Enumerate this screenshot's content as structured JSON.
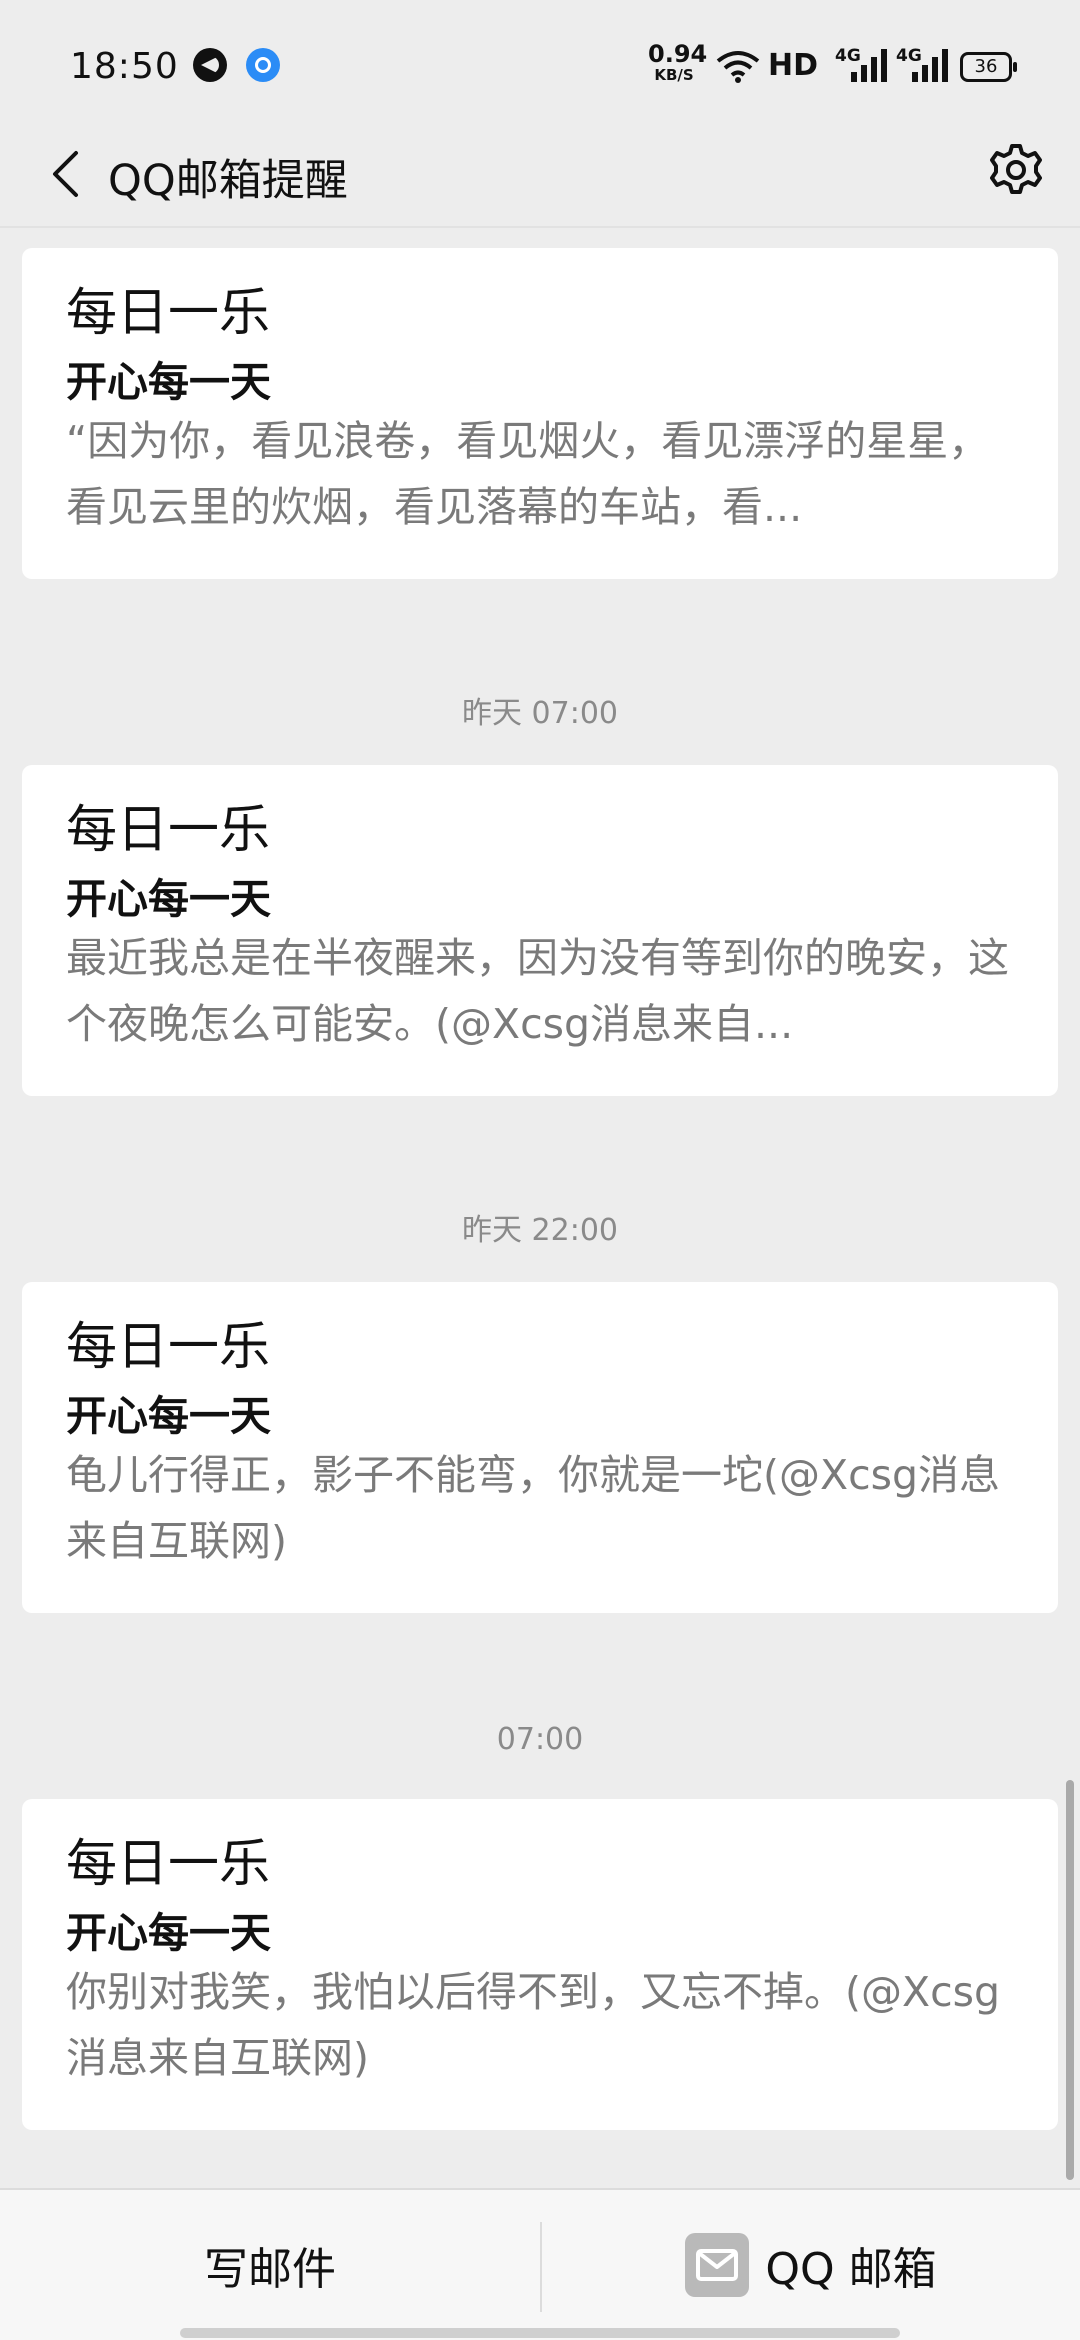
{
  "status_bar": {
    "time": "18:50",
    "net_speed_value": "0.94",
    "net_speed_unit": "KB/S",
    "hd_label": "HD",
    "sim1_label": "4G",
    "sim2_label": "4G",
    "battery": "36"
  },
  "header": {
    "title": "QQ邮箱提醒"
  },
  "feed": [
    {
      "time": "",
      "title": "每日一乐",
      "subtitle": "开心每一天",
      "body": "“因为你，看见浪卷，看见烟火，看见漂浮的星星，看见云里的炊烟，看见落幕的车站，看..."
    },
    {
      "time": "昨天 07:00",
      "title": "每日一乐",
      "subtitle": "开心每一天",
      "body": "最近我总是在半夜醒来，因为没有等到你的晚安，这个夜晚怎么可能安。(@Xcsg消息来自..."
    },
    {
      "time": "昨天 22:00",
      "title": "每日一乐",
      "subtitle": "开心每一天",
      "body": "龟儿行得正，影子不能弯，你就是一坨(@Xcsg消息来自互联网)"
    },
    {
      "time": "07:00",
      "title": "每日一乐",
      "subtitle": "开心每一天",
      "body": "你别对我笑，我怕以后得不到，又忘不掉。(@Xcsg消息来自互联网)"
    }
  ],
  "bottom_bar": {
    "compose_label": "写邮件",
    "mailbox_label": "QQ 邮箱"
  },
  "icons": {
    "back": "chevron-left-icon",
    "settings": "gear-icon",
    "mail": "envelope-icon"
  }
}
